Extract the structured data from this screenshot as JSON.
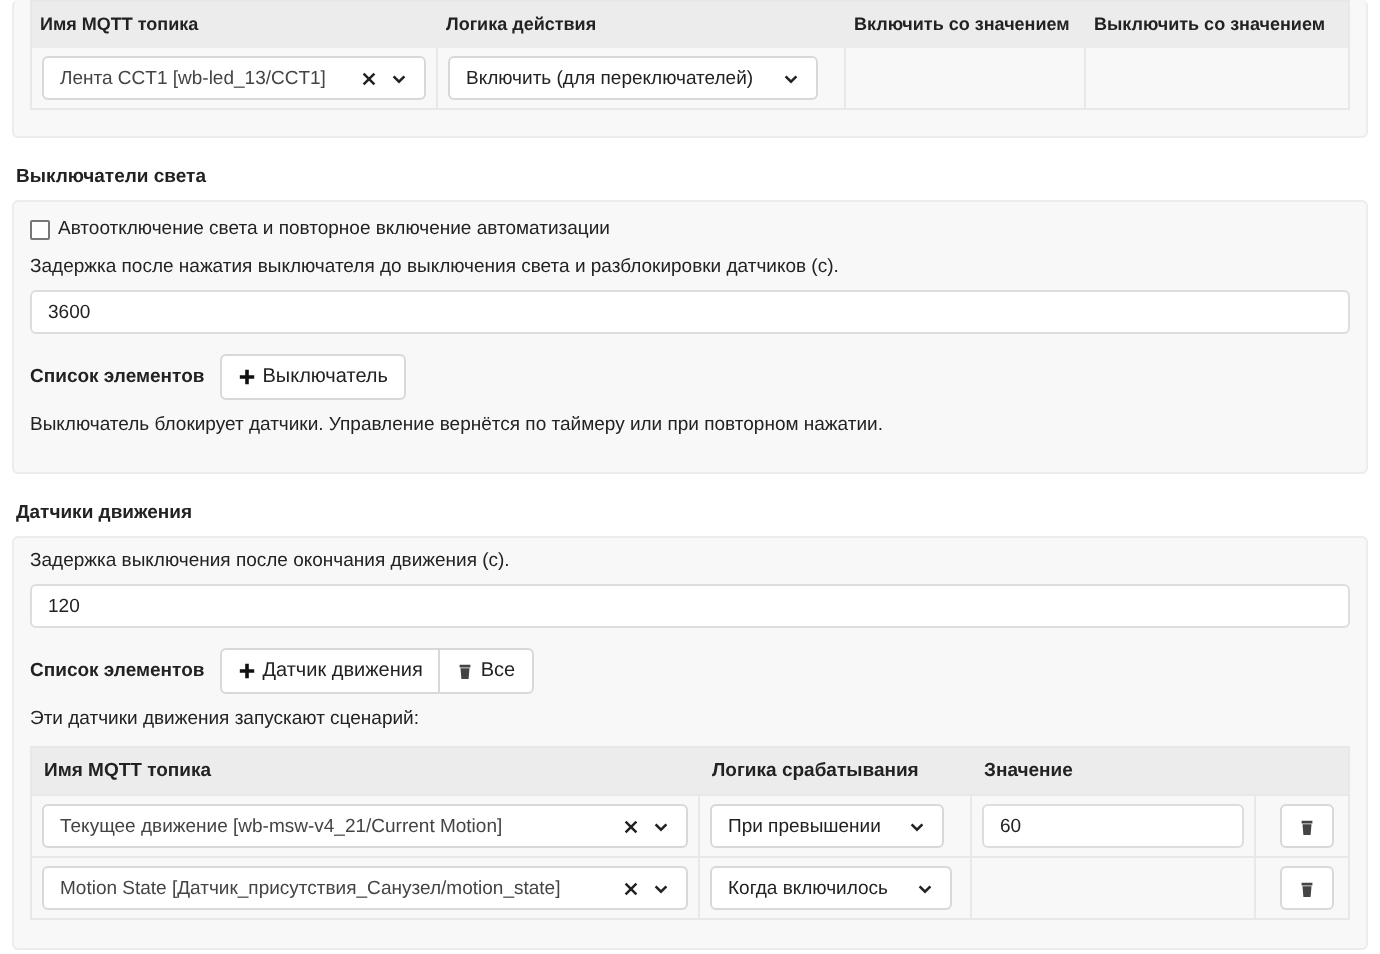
{
  "top_table": {
    "columns": [
      "Имя MQTT топика",
      "Логика действия",
      "Включить со значением",
      "Выключить со значением"
    ],
    "rows": [
      {
        "topic": "Лента CCT1 [wb-led_13/CCT1]",
        "logic": "Включить (для переключателей)"
      }
    ]
  },
  "switches": {
    "title": "Выключатели света",
    "auto_off": {
      "label": "Автоотключение света и повторное включение автоматизации",
      "checked": false
    },
    "delay_label": "Задержка после нажатия выключателя до выключения света и разблокировки датчиков (с).",
    "delay_value": "3600",
    "list_label": "Список элементов",
    "buttons": [
      {
        "label": "Выключатель",
        "kind": "plus"
      }
    ],
    "note": "Выключатель блокирует датчики. Управление вернётся по таймеру или при повторном нажатии."
  },
  "motion": {
    "title": "Датчики движения",
    "delay_label": "Задержка выключения после окончания движения (с).",
    "delay_value": "120",
    "list_label": "Список элементов",
    "buttons": [
      {
        "label": "Датчик движения",
        "kind": "plus"
      },
      {
        "label": "Все",
        "kind": "trash"
      }
    ],
    "note": "Эти датчики движения запускают сценарий:",
    "table": {
      "columns": [
        "Имя MQTT топика",
        "Логика срабатывания",
        "Значение"
      ],
      "rows": [
        {
          "topic": "Текущее движение [wb-msw-v4_21/Current Motion]",
          "logic": "При превышении",
          "value": "60"
        },
        {
          "topic": "Motion State [Датчик_присутствия_Санузел/motion_state]",
          "logic": "Когда включилось"
        }
      ]
    }
  }
}
